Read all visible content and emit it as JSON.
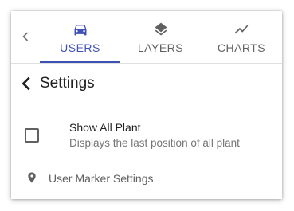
{
  "tabs": {
    "users_label": "USERS",
    "layers_label": "LAYERS",
    "charts_label": "CHARTS",
    "active": "users"
  },
  "settings": {
    "title": "Settings"
  },
  "show_all_plant": {
    "label": "Show All Plant",
    "description": "Displays the last position of all plant",
    "checked": false
  },
  "user_marker": {
    "label": "User Marker Settings"
  },
  "colors": {
    "accent": "#3f51b5",
    "text_primary": "#212121",
    "text_secondary": "#757575",
    "icon": "#616161"
  }
}
